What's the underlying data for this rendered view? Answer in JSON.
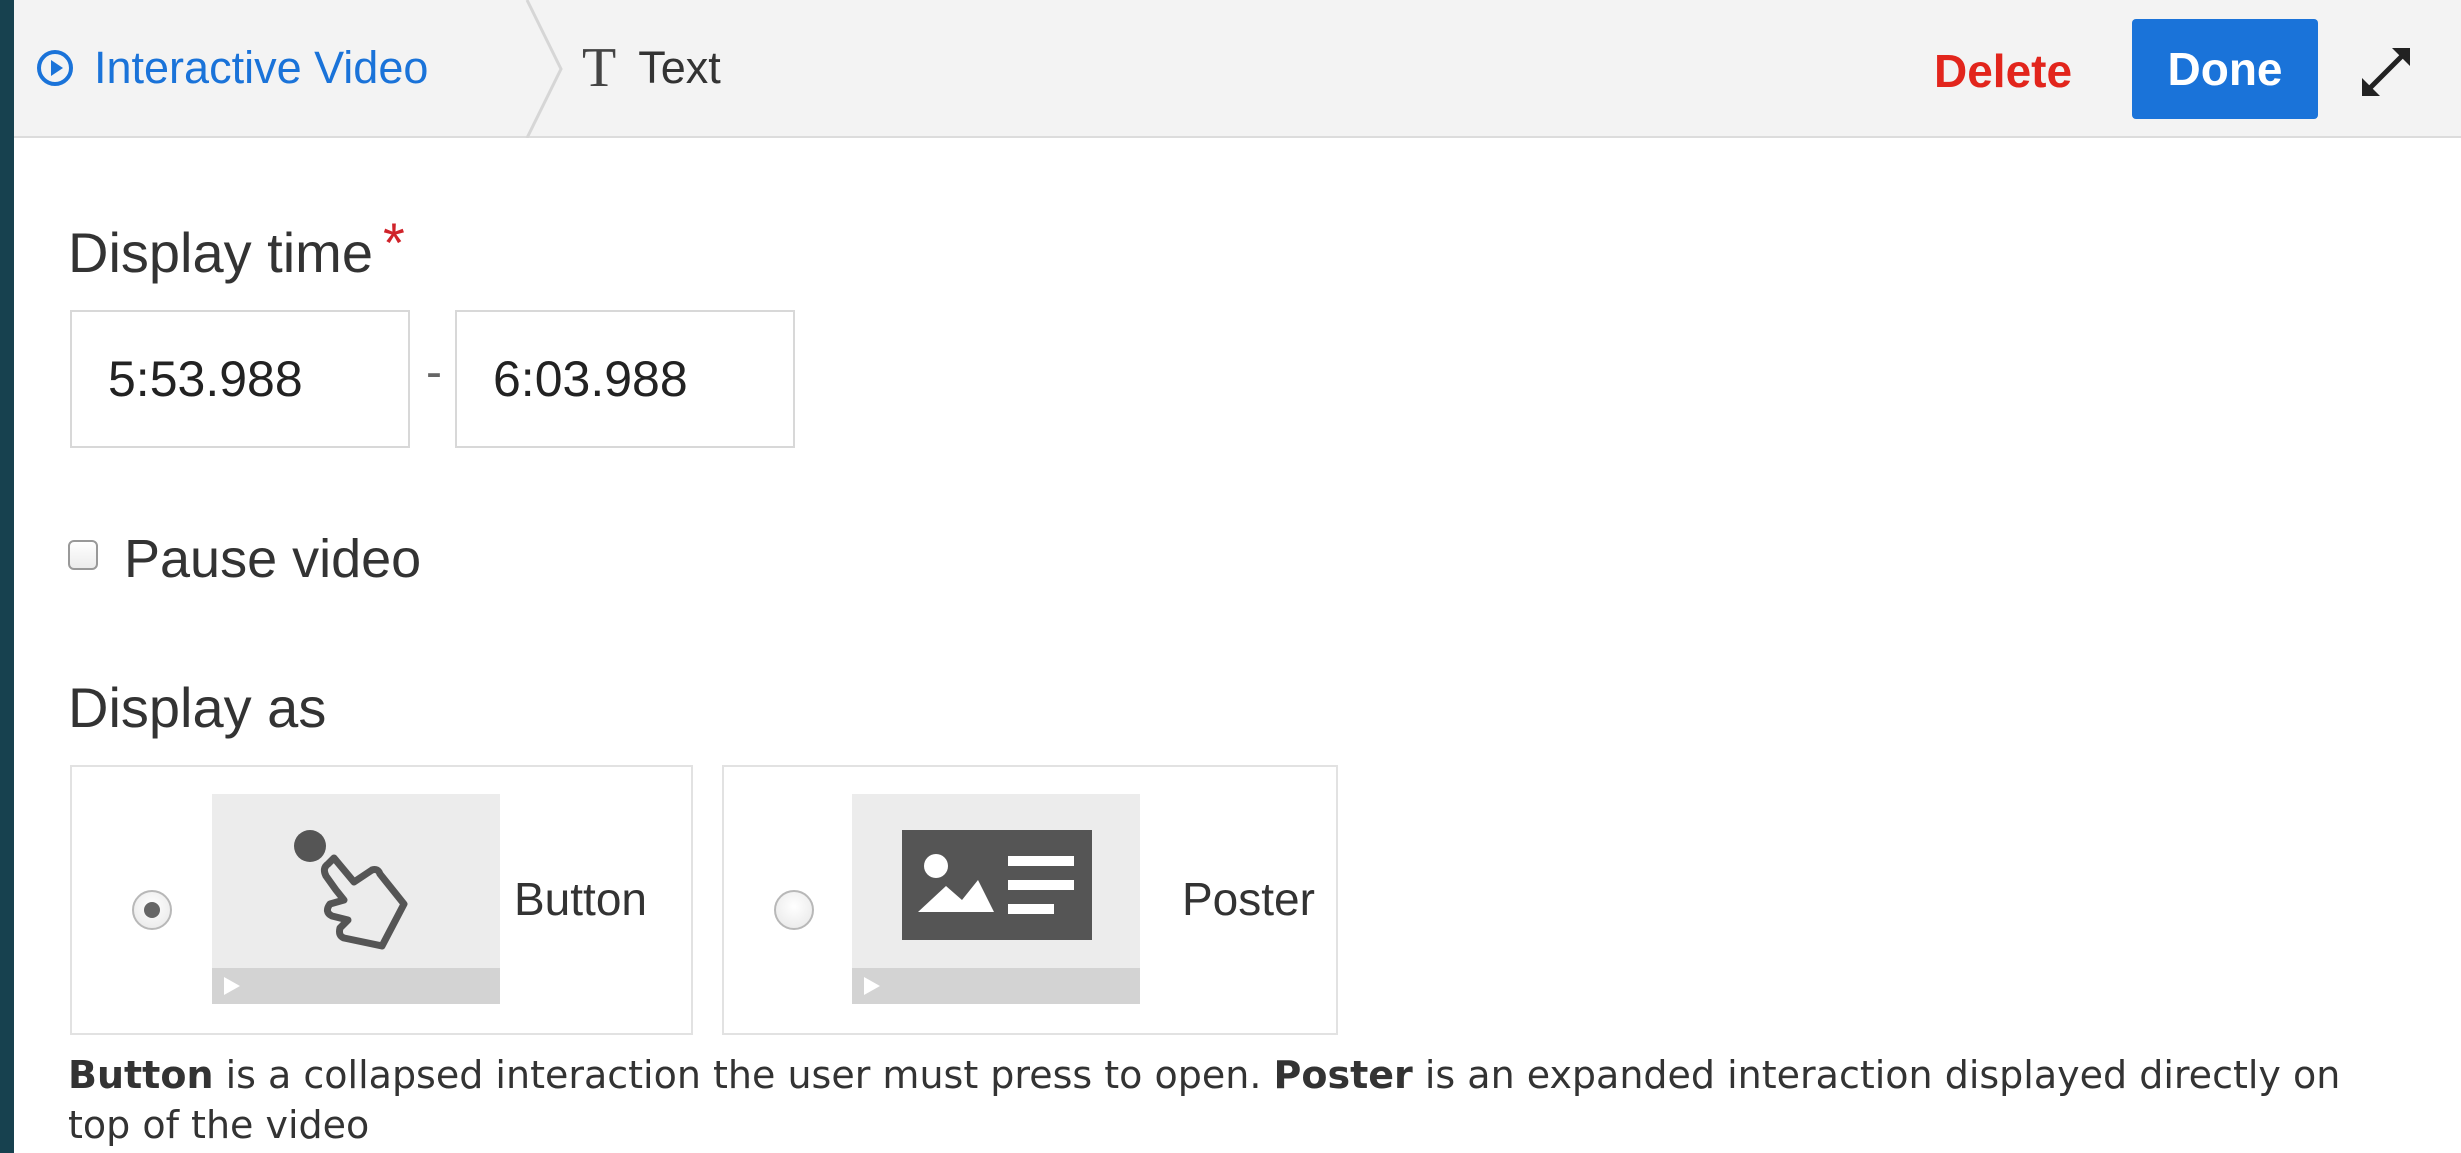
{
  "header": {
    "breadcrumb_root": "Interactive Video",
    "breadcrumb_current": "Text",
    "delete_label": "Delete",
    "done_label": "Done",
    "accent_color": "#1a73d9",
    "delete_color": "#e2251c"
  },
  "form": {
    "display_time_label": "Display time",
    "required_mark": "*",
    "start_time": "5:53.988",
    "time_separator": "-",
    "end_time": "6:03.988",
    "pause_video_label": "Pause video",
    "pause_video_checked": false,
    "display_as_label": "Display as",
    "options": [
      {
        "label": "Button",
        "selected": true,
        "icon": "pointer-hand-icon"
      },
      {
        "label": "Poster",
        "selected": false,
        "icon": "poster-image-text-icon"
      }
    ],
    "help": {
      "term1": "Button",
      "text1": " is a collapsed interaction the user must press to open. ",
      "term2": "Poster",
      "text2": " is an expanded interaction displayed directly on top of the video"
    }
  }
}
